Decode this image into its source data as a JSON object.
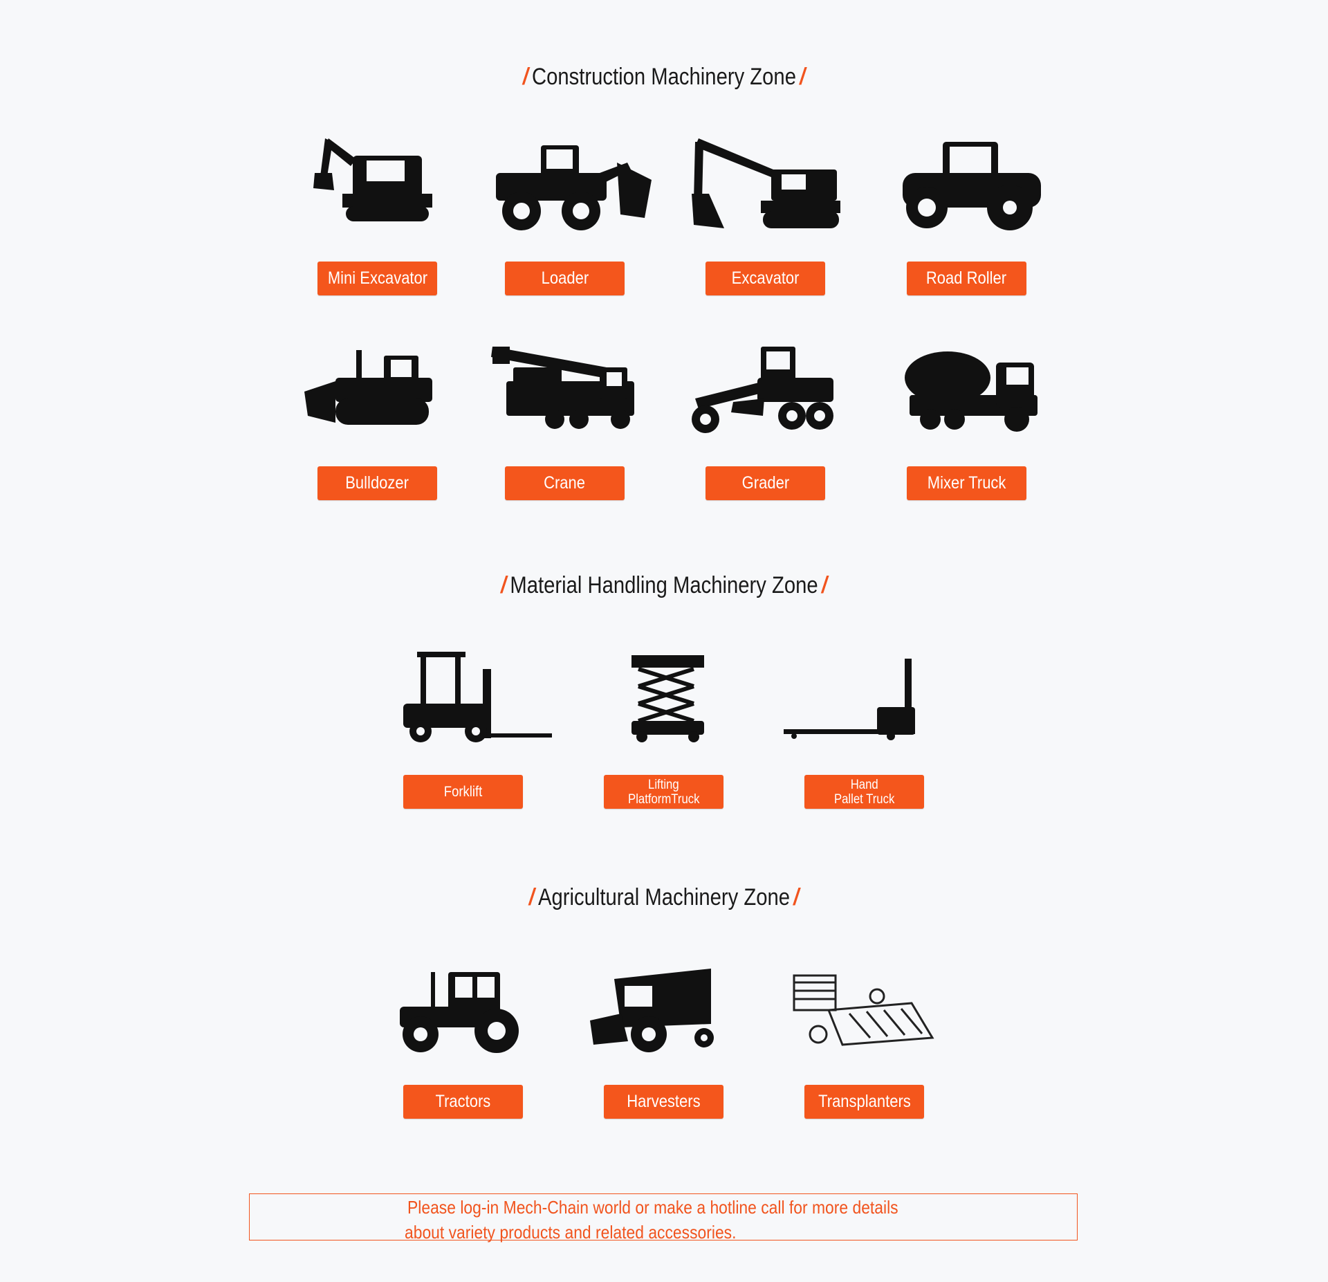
{
  "zones": {
    "construction": {
      "title": "Construction Machinery Zone",
      "items": [
        "Mini Excavator",
        "Loader",
        "Excavator",
        "Road Roller",
        "Bulldozer",
        "Crane",
        "Grader",
        "Mixer Truck"
      ]
    },
    "material": {
      "title": "Material Handling Machinery Zone",
      "items": [
        {
          "line1": "Forklift"
        },
        {
          "line1": "Lifting",
          "line2": "PlatformTruck"
        },
        {
          "line1": "Hand",
          "line2": "Pallet Truck"
        }
      ]
    },
    "agricultural": {
      "title": "Agricultural Machinery Zone",
      "items": [
        "Tractors",
        "Harvesters",
        "Transplanters"
      ]
    }
  },
  "notice": {
    "line1": "Please log-in Mech-Chain world or make a hotline call for more details",
    "line2": "about variety products and related accessories."
  },
  "colors": {
    "accent": "#f4561c",
    "background": "#f7f8fa",
    "icon": "#111111"
  }
}
